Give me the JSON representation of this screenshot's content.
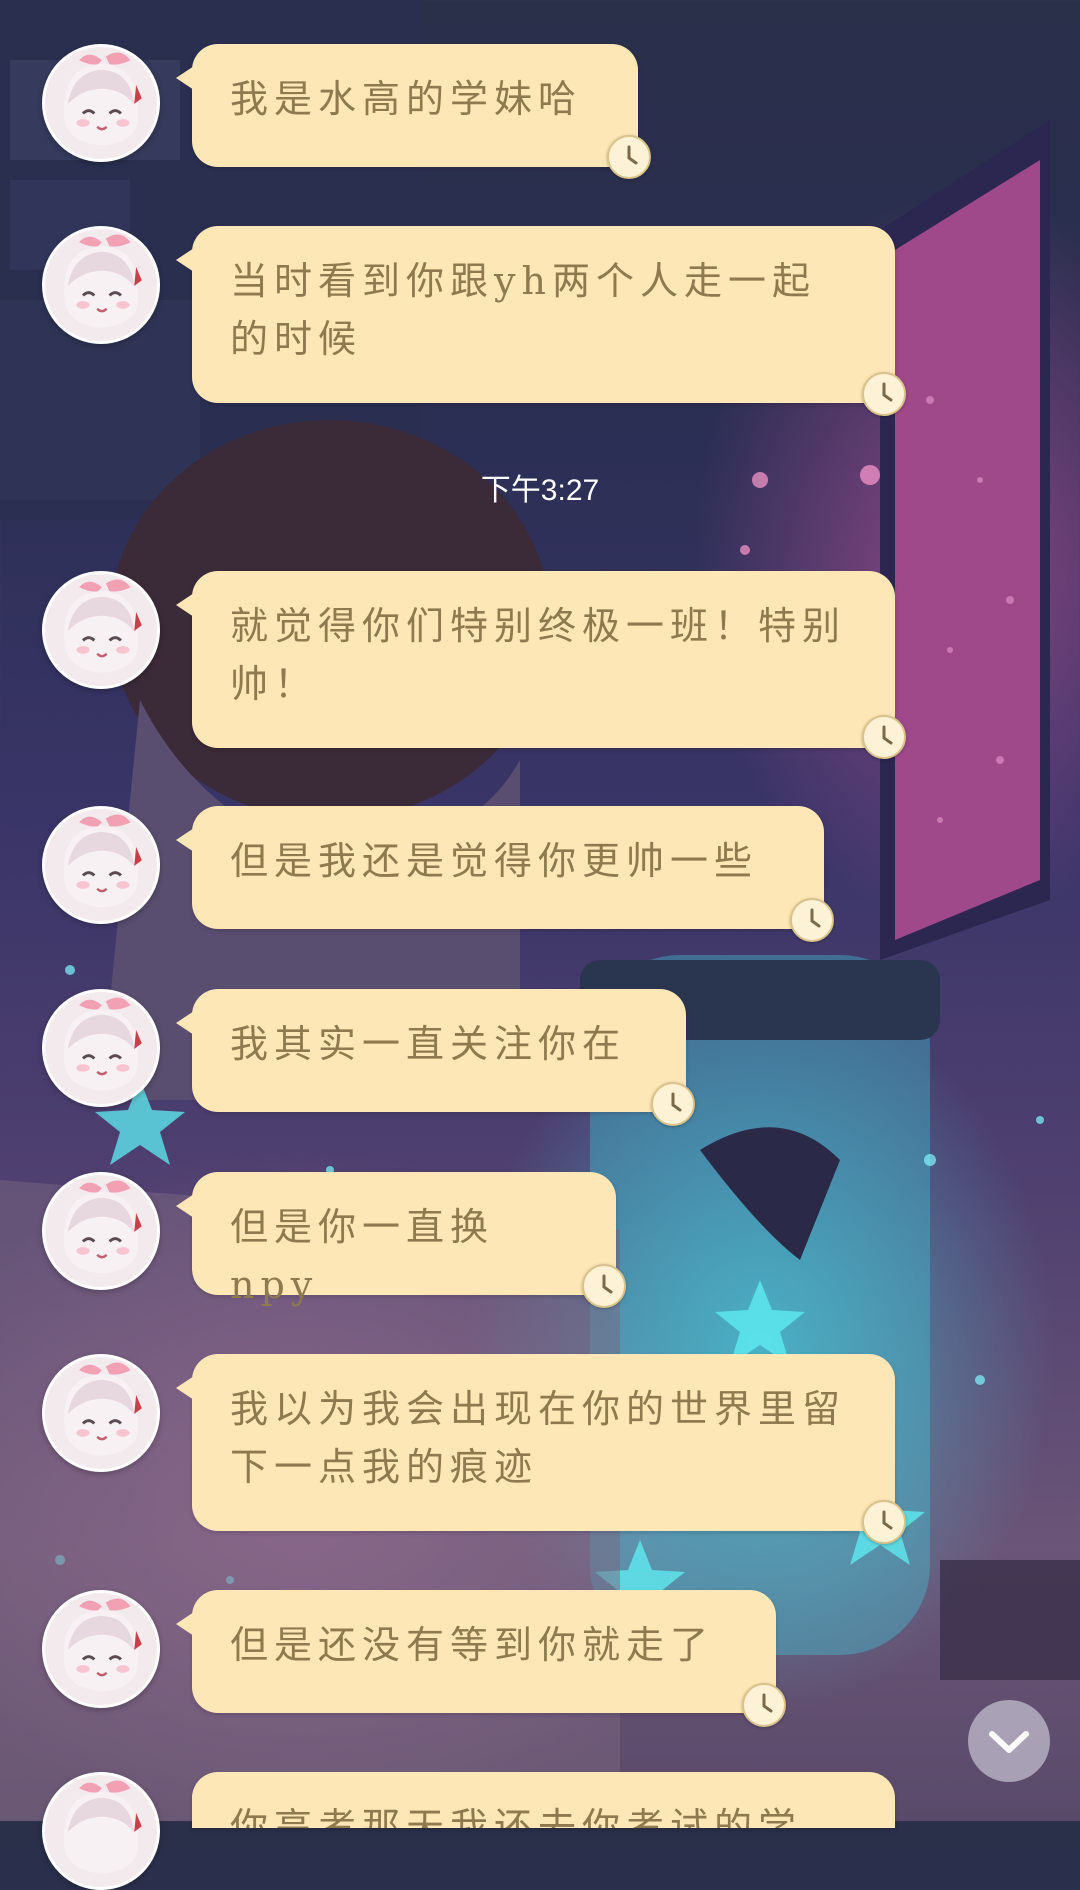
{
  "chat": {
    "time_divider": "下午3:27",
    "messages": [
      {
        "text": "我是水高的学妹哈"
      },
      {
        "text": "当时看到你跟yh两个人走一起的时候"
      },
      {
        "text": "就觉得你们特别终极一班！特别帅！"
      },
      {
        "text": "但是我还是觉得你更帅一些"
      },
      {
        "text": "我其实一直关注你在"
      },
      {
        "text": "但是你一直换npy"
      },
      {
        "text": "我以为我会出现在你的世界里留下一点我的痕迹"
      },
      {
        "text": "但是还没有等到你就走了"
      },
      {
        "text": "你高考那天我还去你考试的学"
      }
    ]
  },
  "icons": {
    "avatar": "anime-girl-avatar-icon",
    "status": "clock-icon",
    "scroll": "chevron-down-icon"
  },
  "colors": {
    "bubble": "#fde7b6",
    "bubble_text": "#8e7a4e"
  }
}
